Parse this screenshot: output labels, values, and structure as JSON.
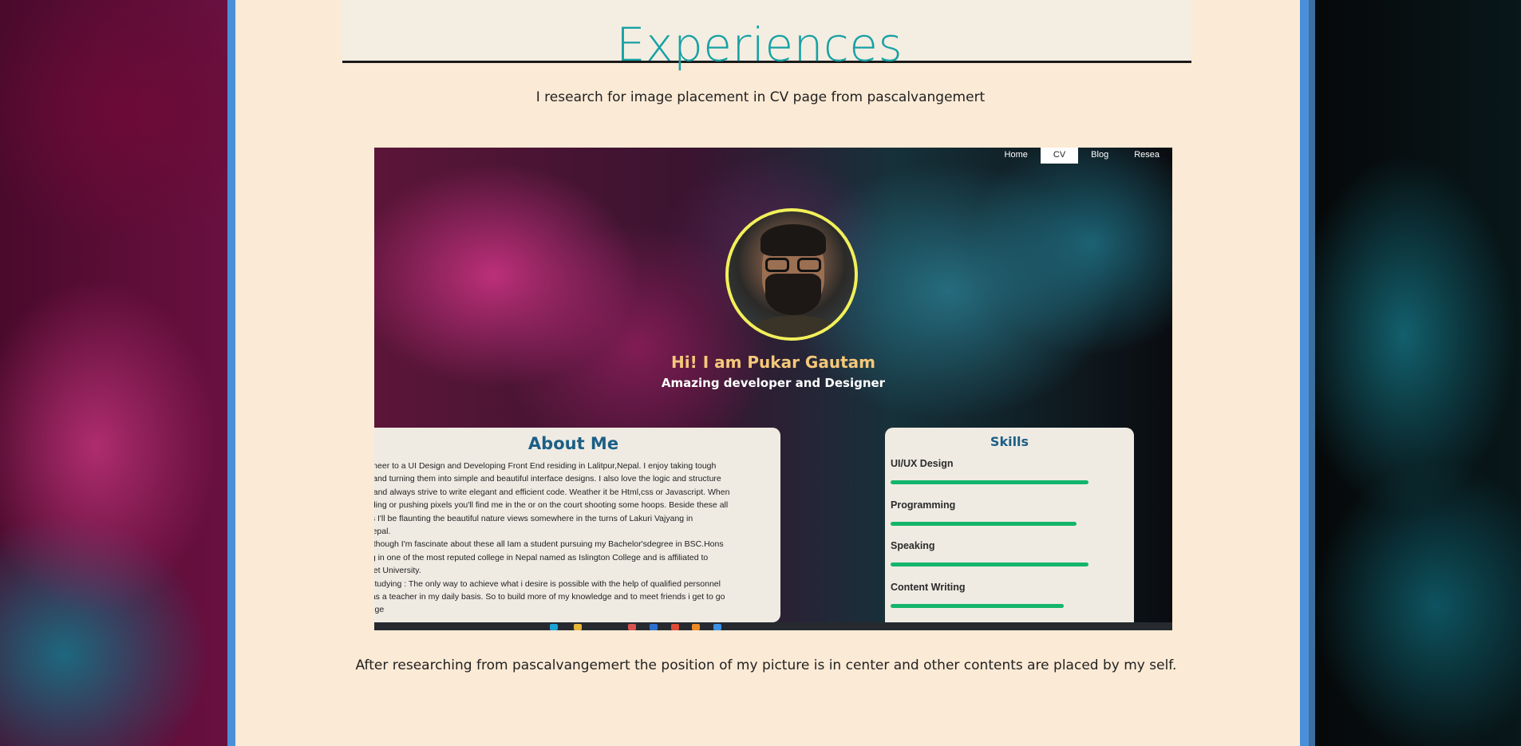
{
  "page": {
    "title": "Experiences",
    "intro": "I research for image placement in CV page from pascalvangemert",
    "outro": "After researching from pascalvangemert the position of my picture is in center and other contents are placed by my self."
  },
  "screenshot": {
    "nav": [
      "Home",
      "CV",
      "Blog",
      "Resea"
    ],
    "nav_active": "CV",
    "hero_name": "Hi! I am Pukar Gautam",
    "hero_sub": "Amazing developer and Designer",
    "about_title": "About Me",
    "about_text": "gineer to a UI Design and Developing Front End residing in Lalitpur,Nepal. I enjoy taking tough\ns and turning them into simple and beautiful interface designs. I also love the logic and structure\ng and always strive to write elegant and efficient code. Weather it be Html,css or Javascript. When\noding or pushing pixels you'll find me in the or on the court shooting some hoops. Beside these all\nes I'll be flaunting the beautiful nature views somewhere in the turns of Lakuri Vajyang in\nNepal.\no though I'm fascinate about these all Iam a student pursuing my Bachelor'sdegree in BSC.Hons\nng in one of the most reputed college in Nepal named as Islington College and is affiliated to\nMet University.\ni studying : The only way to achieve what i desire is possible with the help of qualified personnel\nt as a teacher in my daily basis. So to build more of my knowledge and to meet friends i get to go\nllege",
    "skills_title": "Skills",
    "skills": [
      {
        "name": "UI/UX Design",
        "level": 0.8
      },
      {
        "name": "Programming",
        "level": 0.75
      },
      {
        "name": "Speaking",
        "level": 0.8
      },
      {
        "name": "Content Writing",
        "level": 0.7
      }
    ]
  },
  "colors": {
    "title": "#17a1a4",
    "page_bg": "#fbead5",
    "frame": "#4a90d9",
    "skill_bar": "#13b56b",
    "hero_name": "#f4c87a",
    "about_heading": "#1c5f86"
  }
}
